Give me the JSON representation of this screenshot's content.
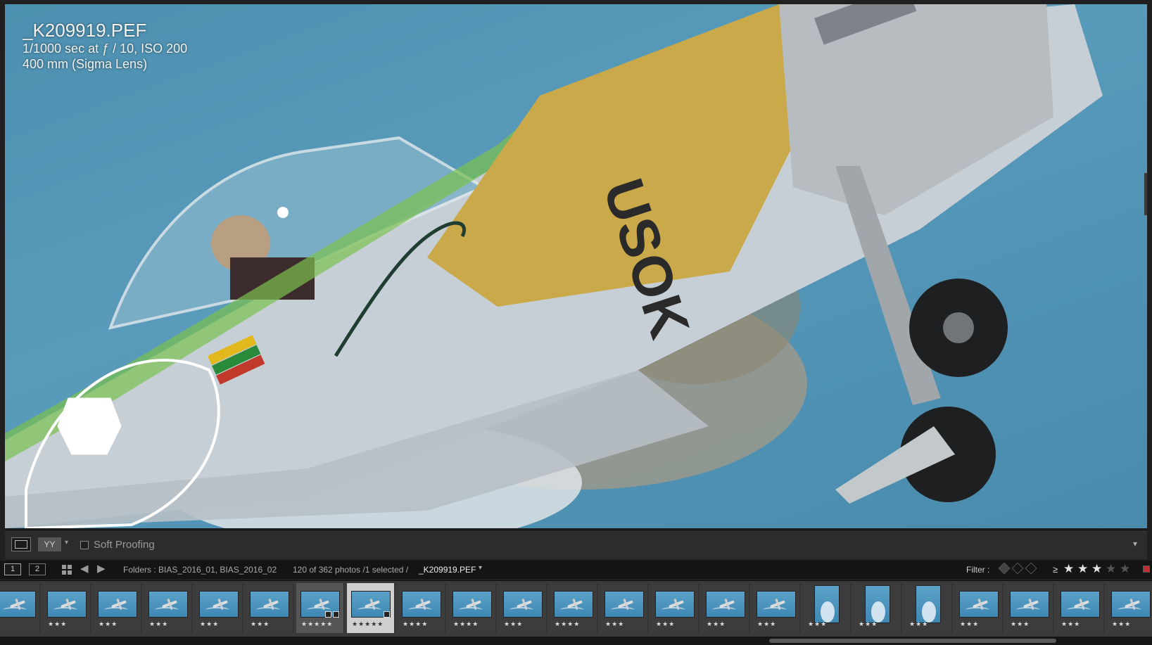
{
  "photo": {
    "filename": "_K209919.PEF",
    "exposure": "1/1000 sec at ƒ / 10, ISO 200",
    "lens": "400 mm (Sigma Lens)"
  },
  "toolbar": {
    "view_compare_label": "YY",
    "soft_proofing_label": "Soft Proofing",
    "soft_proofing_checked": false
  },
  "filmstrip_header": {
    "screen1_label": "1",
    "screen2_label": "2",
    "folders_text": "Folders : BIAS_2016_01, BIAS_2016_02",
    "count_text": "120 of 362 photos /1 selected /",
    "selected_filename": "_K209919.PEF",
    "filter_label": "Filter :",
    "rating_operator": "≥",
    "rating_filter": 3
  },
  "filmstrip": {
    "thumbnails": [
      {
        "stars": "",
        "orientation": "land",
        "state": "normal"
      },
      {
        "stars": "★★★",
        "orientation": "land",
        "state": "normal"
      },
      {
        "stars": "★★★",
        "orientation": "land",
        "state": "normal"
      },
      {
        "stars": "★★★",
        "orientation": "land",
        "state": "normal"
      },
      {
        "stars": "★★★",
        "orientation": "land",
        "state": "normal"
      },
      {
        "stars": "★★★",
        "orientation": "land",
        "state": "normal"
      },
      {
        "stars": "★★★★★",
        "orientation": "land",
        "state": "in-sel"
      },
      {
        "stars": "★★★★★",
        "orientation": "land",
        "state": "selected"
      },
      {
        "stars": "★★★★",
        "orientation": "land",
        "state": "normal"
      },
      {
        "stars": "★★★★",
        "orientation": "land",
        "state": "normal"
      },
      {
        "stars": "★★★",
        "orientation": "land",
        "state": "normal"
      },
      {
        "stars": "★★★★",
        "orientation": "land",
        "state": "normal"
      },
      {
        "stars": "★★★",
        "orientation": "land",
        "state": "normal"
      },
      {
        "stars": "★★★",
        "orientation": "land",
        "state": "normal"
      },
      {
        "stars": "★★★",
        "orientation": "land",
        "state": "normal"
      },
      {
        "stars": "★★★",
        "orientation": "land",
        "state": "normal"
      },
      {
        "stars": "★★★",
        "orientation": "port",
        "state": "normal"
      },
      {
        "stars": "★★★",
        "orientation": "port",
        "state": "normal"
      },
      {
        "stars": "★★★",
        "orientation": "port",
        "state": "normal"
      },
      {
        "stars": "★★★",
        "orientation": "land",
        "state": "normal"
      },
      {
        "stars": "★★★",
        "orientation": "land",
        "state": "normal"
      },
      {
        "stars": "★★★",
        "orientation": "land",
        "state": "normal"
      },
      {
        "stars": "★★★",
        "orientation": "land",
        "state": "normal"
      }
    ]
  },
  "colors": {
    "sky": "#4f92b4",
    "panel": "#2c2c2c",
    "filmstrip_bg": "#3a3a3a",
    "selected_cell": "#cfcfcf"
  }
}
